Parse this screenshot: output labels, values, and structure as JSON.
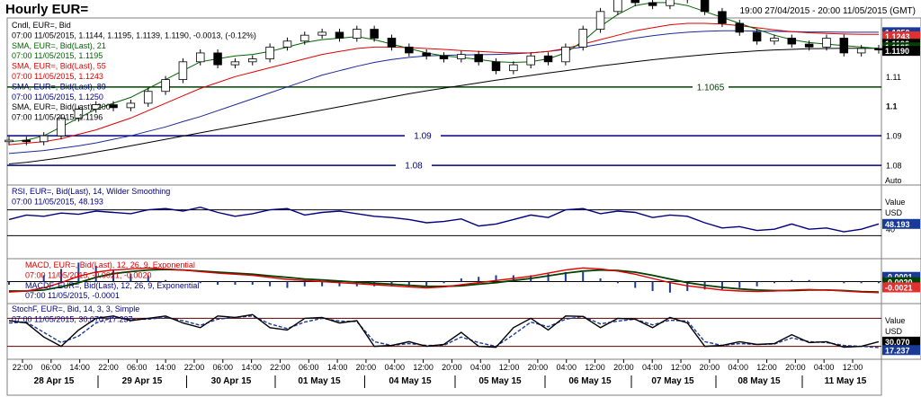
{
  "header": {
    "title": "Hourly EUR=",
    "range": "19:00 27/04/2015 - 20:00 11/05/2015 (GMT)"
  },
  "chart_data": {
    "type": "line",
    "x_ticks": [
      "22:00",
      "06:00",
      "14:00",
      "22:00",
      "06:00",
      "14:00",
      "22:00",
      "06:00",
      "14:00",
      "22:00",
      "06:00",
      "14:00",
      "20:00",
      "04:00",
      "12:00",
      "20:00",
      "04:00",
      "12:00",
      "20:00",
      "04:00",
      "12:00",
      "20:00",
      "04:00",
      "12:00",
      "20:00",
      "04:00",
      "12:00",
      "20:00",
      "04:00",
      "12:00"
    ],
    "days": [
      "28 Apr 15",
      "29 Apr 15",
      "30 Apr 15",
      "01 May 15",
      "04 May 15",
      "05 May 15",
      "06 May 15",
      "07 May 15",
      "08 May 15",
      "11 May 15"
    ],
    "price_panel": {
      "ylim": [
        1.077,
        1.128
      ],
      "y_ticks": [
        "1.11",
        "1.1",
        "1.09",
        "1.08"
      ],
      "y_tick_values": [
        1.11,
        1.1,
        1.09,
        1.08
      ],
      "legend": [
        {
          "text": "Cndl, EUR=, Bid",
          "color": "#000000"
        },
        {
          "text": "07:00 11/05/2015, 1.1144, 1.1195, 1.1139, 1.1190, -0.0013, (-0.12%)",
          "color": "#000000"
        },
        {
          "text": "SMA, EUR=, Bid(Last), 21",
          "color": "#006400"
        },
        {
          "text": "07:00 11/05/2015, 1.1195",
          "color": "#006400"
        },
        {
          "text": "SMA, EUR=, Bid(Last), 55",
          "color": "#e00000"
        },
        {
          "text": "07:00 11/05/2015, 1.1243",
          "color": "#e00000"
        },
        {
          "text": "SMA, EUR=, Bid(Last), 89",
          "color": "#000080"
        },
        {
          "text": "07:00 11/05/2015, 1.1250",
          "color": "#000080"
        },
        {
          "text": "SMA, EUR=, Bid(Last), 200",
          "color": "#000000"
        },
        {
          "text": "07:00 11/05/2015, 1.1196",
          "color": "#000000"
        }
      ],
      "hlines": [
        {
          "value": 1.1065,
          "label": "1.1065",
          "color": "#004000"
        },
        {
          "value": 1.09,
          "label": "1.09",
          "color": "#000080"
        },
        {
          "value": 1.08,
          "label": "1.08",
          "color": "#000080"
        }
      ],
      "price_labels": [
        {
          "text": "1.1250",
          "bg": "#1a3a9a",
          "fg": "#ffffff",
          "value": 1.125
        },
        {
          "text": "1.1243",
          "bg": "#e03030",
          "fg": "#ffffff",
          "value": 1.1236
        },
        {
          "text": "1.1196",
          "bg": "#000000",
          "fg": "#ffffff",
          "value": 1.1211
        },
        {
          "text": "1.1195",
          "bg": "#004000",
          "fg": "#ffffff",
          "value": 1.1199
        },
        {
          "text": "1.1190",
          "bg": "#000000",
          "fg": "#ffffff",
          "value": 1.1187
        }
      ],
      "closes": [
        1.0885,
        1.088,
        1.09,
        1.096,
        1.099,
        1.1005,
        1.0995,
        1.101,
        1.105,
        1.109,
        1.115,
        1.118,
        1.114,
        1.115,
        1.116,
        1.12,
        1.122,
        1.124,
        1.125,
        1.123,
        1.126,
        1.123,
        1.12,
        1.118,
        1.117,
        1.116,
        1.1175,
        1.115,
        1.112,
        1.114,
        1.117,
        1.115,
        1.12,
        1.126,
        1.132,
        1.138,
        1.135,
        1.134,
        1.136,
        1.138,
        1.132,
        1.128,
        1.125,
        1.122,
        1.123,
        1.121,
        1.12,
        1.123,
        1.118,
        1.1195,
        1.119
      ],
      "sma21": [
        1.088,
        1.0885,
        1.09,
        1.093,
        1.096,
        1.099,
        1.101,
        1.103,
        1.106,
        1.109,
        1.112,
        1.115,
        1.116,
        1.117,
        1.1175,
        1.1185,
        1.12,
        1.1215,
        1.1225,
        1.123,
        1.1235,
        1.1225,
        1.121,
        1.1195,
        1.118,
        1.117,
        1.1165,
        1.1158,
        1.115,
        1.1148,
        1.115,
        1.116,
        1.118,
        1.122,
        1.127,
        1.131,
        1.134,
        1.135,
        1.135,
        1.134,
        1.132,
        1.13,
        1.128,
        1.126,
        1.124,
        1.1225,
        1.1215,
        1.121,
        1.1205,
        1.12,
        1.1195
      ],
      "sma55": [
        1.087,
        1.0875,
        1.088,
        1.089,
        1.0905,
        1.092,
        1.094,
        1.096,
        1.0985,
        1.101,
        1.1035,
        1.106,
        1.108,
        1.11,
        1.1115,
        1.113,
        1.1145,
        1.116,
        1.1175,
        1.1185,
        1.1195,
        1.12,
        1.12,
        1.1198,
        1.1195,
        1.1192,
        1.1188,
        1.1185,
        1.1182,
        1.118,
        1.118,
        1.1185,
        1.1195,
        1.121,
        1.1225,
        1.124,
        1.1255,
        1.1265,
        1.1275,
        1.128,
        1.128,
        1.1278,
        1.1272,
        1.1265,
        1.1258,
        1.1252,
        1.1248,
        1.1246,
        1.1244,
        1.1243,
        1.1243
      ],
      "sma89": [
        1.084,
        1.0845,
        1.085,
        1.0858,
        1.0866,
        1.0876,
        1.0888,
        1.09,
        1.0915,
        1.093,
        1.0948,
        1.0965,
        1.0985,
        1.1005,
        1.1025,
        1.1045,
        1.1065,
        1.1085,
        1.1105,
        1.112,
        1.1135,
        1.1148,
        1.1158,
        1.1165,
        1.117,
        1.1172,
        1.1173,
        1.1174,
        1.1175,
        1.1177,
        1.118,
        1.1185,
        1.1192,
        1.12,
        1.121,
        1.122,
        1.123,
        1.1238,
        1.1245,
        1.125,
        1.1253,
        1.1255,
        1.1255,
        1.1254,
        1.1253,
        1.1252,
        1.1251,
        1.1251,
        1.125,
        1.125,
        1.125
      ],
      "sma200": [
        1.0805,
        1.081,
        1.0818,
        1.0826,
        1.0835,
        1.0845,
        1.0855,
        1.0866,
        1.0877,
        1.0888,
        1.0899,
        1.091,
        1.0921,
        1.0932,
        1.0943,
        1.0954,
        1.0965,
        1.0976,
        1.0987,
        1.0998,
        1.1009,
        1.102,
        1.1031,
        1.1042,
        1.1052,
        1.1061,
        1.107,
        1.1079,
        1.1088,
        1.1096,
        1.1104,
        1.1112,
        1.112,
        1.1128,
        1.1136,
        1.1143,
        1.115,
        1.1157,
        1.1163,
        1.1169,
        1.1174,
        1.1179,
        1.1183,
        1.1187,
        1.119,
        1.1192,
        1.1194,
        1.1195,
        1.1196,
        1.1196,
        1.1196
      ]
    },
    "rsi_panel": {
      "legend": [
        {
          "text": "RSI, EUR=, Bid(Last), 14, Wilder Smoothing",
          "color": "#000080"
        },
        {
          "text": "07:00 11/05/2015, 48.193",
          "color": "#000080"
        }
      ],
      "unit_labels": [
        "Value",
        "USD"
      ],
      "ylim": [
        0,
        100
      ],
      "y_ticks": [
        "40"
      ],
      "y_tick_values": [
        40
      ],
      "levels": [
        70,
        30
      ],
      "current": {
        "text": "48.193",
        "value": 48.193
      },
      "values": [
        55,
        62,
        60,
        65,
        63,
        68,
        66,
        64,
        70,
        72,
        68,
        74,
        66,
        60,
        64,
        70,
        72,
        62,
        66,
        68,
        64,
        60,
        58,
        55,
        50,
        52,
        56,
        45,
        48,
        55,
        62,
        58,
        70,
        72,
        64,
        68,
        66,
        58,
        62,
        60,
        50,
        42,
        44,
        38,
        40,
        48,
        40,
        42,
        36,
        40,
        48.193
      ]
    },
    "macd_panel": {
      "legend": [
        {
          "text": "MACD, EUR=, Bid(Last), 12, 26, 9, Exponential",
          "color": "#e00000"
        },
        {
          "text": "07:00 11/05/2015, -0.0021, -0.0020",
          "color": "#e00000"
        },
        {
          "text": "MACDF, EUR=, Bid(Last), 12, 26, 9, Exponential",
          "color": "#000080"
        },
        {
          "text": "07:00 11/05/2015, -0.0001",
          "color": "#000080"
        }
      ],
      "ylim": [
        -0.0035,
        0.0035
      ],
      "labels": [
        {
          "text": "-0.0001",
          "bg": "#1a3a9a",
          "fg": "#ffffff",
          "value": 0.0009
        },
        {
          "text": "-0.0020",
          "bg": "#004000",
          "fg": "#ffffff",
          "value": -0.0001
        },
        {
          "text": "-0.0021",
          "bg": "#e03030",
          "fg": "#ffffff",
          "value": -0.0011
        }
      ],
      "macd": [
        -0.002,
        -0.0018,
        -0.0012,
        -0.0002,
        0.001,
        0.0018,
        0.0022,
        0.0024,
        0.0026,
        0.0024,
        0.0022,
        0.0019,
        0.0016,
        0.0014,
        0.0012,
        0.0008,
        0.0004,
        0.0002,
        0.0,
        -0.0002,
        -0.0004,
        -0.0006,
        -0.0008,
        -0.001,
        -0.0012,
        -0.001,
        -0.0006,
        -0.0002,
        0.0002,
        0.0006,
        0.001,
        0.0016,
        0.0022,
        0.0026,
        0.0024,
        0.002,
        0.0014,
        0.0006,
        -0.0002,
        -0.0008,
        -0.0012,
        -0.0016,
        -0.0018,
        -0.0019,
        -0.0018,
        -0.0016,
        -0.0015,
        -0.0016,
        -0.0018,
        -0.002,
        -0.0021
      ],
      "signal": [
        -0.0018,
        -0.0018,
        -0.0016,
        -0.001,
        -0.0002,
        0.0008,
        0.0015,
        0.0019,
        0.0022,
        0.0023,
        0.0022,
        0.002,
        0.0018,
        0.0016,
        0.0014,
        0.0011,
        0.0008,
        0.0005,
        0.0003,
        0.0001,
        -0.0001,
        -0.0003,
        -0.0005,
        -0.0007,
        -0.0009,
        -0.0009,
        -0.0008,
        -0.0005,
        -0.0002,
        0.0002,
        0.0006,
        0.0011,
        0.0016,
        0.002,
        0.0022,
        0.0021,
        0.0018,
        0.0012,
        0.0005,
        -0.0002,
        -0.0007,
        -0.0011,
        -0.0014,
        -0.0016,
        -0.0017,
        -0.0017,
        -0.0016,
        -0.0016,
        -0.0017,
        -0.0019,
        -0.002
      ]
    },
    "stoch_panel": {
      "legend": [
        {
          "text": "StochF, EUR=, Bid, 14, 3, 3, Simple",
          "color": "#000080"
        },
        {
          "text": "07:00 11/05/2015, 30.070, 17.237",
          "color": "#000080"
        }
      ],
      "unit_labels": [
        "Value",
        "USD"
      ],
      "ylim": [
        0,
        100
      ],
      "levels": [
        80,
        20
      ],
      "labels": [
        {
          "text": "30.070",
          "bg": "#000000",
          "fg": "#ffffff",
          "value": 30.07
        },
        {
          "text": "17.237",
          "bg": "#1a3a9a",
          "fg": "#ffffff",
          "value": 12
        }
      ],
      "k": [
        75,
        70,
        40,
        20,
        55,
        80,
        85,
        75,
        80,
        85,
        70,
        60,
        85,
        82,
        88,
        60,
        55,
        80,
        82,
        70,
        75,
        20,
        22,
        30,
        20,
        24,
        50,
        20,
        18,
        60,
        80,
        55,
        85,
        84,
        60,
        80,
        78,
        60,
        82,
        70,
        20,
        22,
        30,
        24,
        26,
        45,
        28,
        30,
        18,
        20,
        30.07
      ],
      "d": [
        70,
        72,
        50,
        28,
        42,
        70,
        82,
        78,
        78,
        82,
        75,
        65,
        78,
        82,
        85,
        68,
        58,
        72,
        80,
        74,
        73,
        30,
        22,
        26,
        22,
        22,
        40,
        28,
        20,
        45,
        72,
        62,
        78,
        84,
        68,
        74,
        78,
        66,
        76,
        74,
        30,
        22,
        26,
        24,
        25,
        38,
        30,
        28,
        22,
        20,
        17.237
      ]
    }
  },
  "ui": {
    "auto_label": "Auto"
  }
}
